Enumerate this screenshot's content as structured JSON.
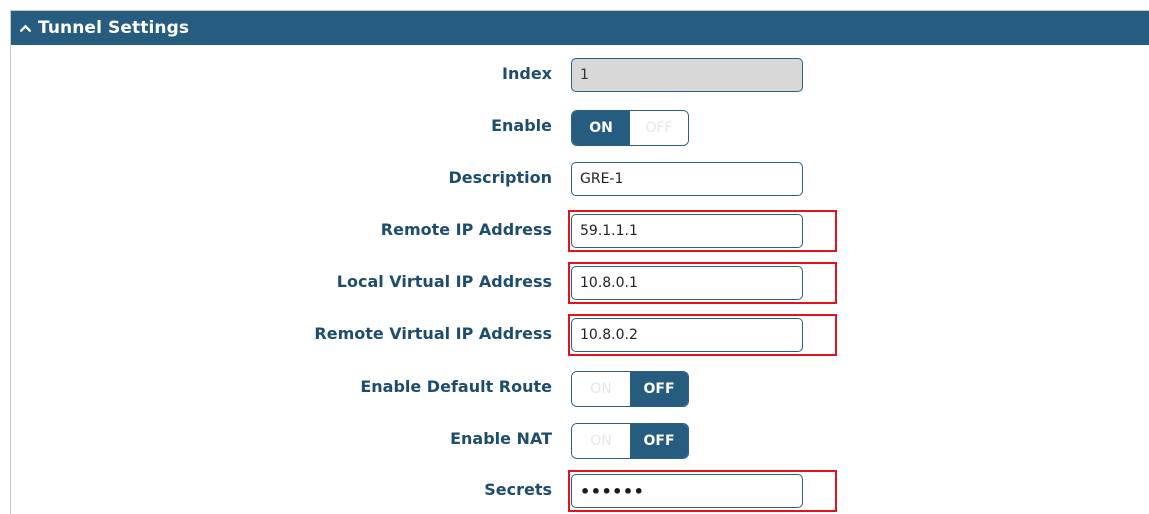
{
  "section": {
    "title": "Tunnel Settings",
    "collapse_icon": "chevron-up-icon"
  },
  "fields": {
    "index": {
      "label": "Index",
      "value": "1"
    },
    "enable": {
      "label": "Enable",
      "on_label": "ON",
      "off_label": "OFF",
      "state": "on"
    },
    "description": {
      "label": "Description",
      "value": "GRE-1"
    },
    "remote_ip": {
      "label": "Remote IP Address",
      "value": "59.1.1.1"
    },
    "local_virtual_ip": {
      "label": "Local Virtual IP Address",
      "value": "10.8.0.1"
    },
    "remote_virtual_ip": {
      "label": "Remote Virtual IP Address",
      "value": "10.8.0.2"
    },
    "default_route": {
      "label": "Enable Default Route",
      "on_label": "ON",
      "off_label": "OFF",
      "state": "off"
    },
    "nat": {
      "label": "Enable NAT",
      "on_label": "ON",
      "off_label": "OFF",
      "state": "off"
    },
    "secrets": {
      "label": "Secrets",
      "value": "••••••"
    }
  },
  "colors": {
    "header_bg": "#255c7f",
    "label_text": "#1e4d6b",
    "highlight": "#e0141e"
  }
}
